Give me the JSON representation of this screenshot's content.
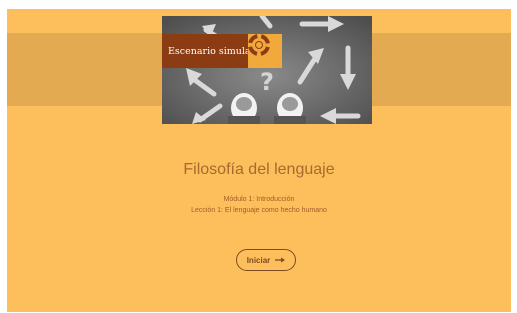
{
  "hero": {
    "badge_label": "Escenario simulado",
    "badge_icon": "lifebuoy-icon",
    "image": "shoes-and-arrows-photo"
  },
  "course": {
    "title": "Filosofía del lenguaje",
    "module": "Módulo 1: Introducción",
    "lesson": "Lección 1: El lenguaje como hecho humano"
  },
  "actions": {
    "start_label": "Iniciar",
    "start_icon": "arrow-right-icon"
  },
  "colors": {
    "background": "#fdbf5c",
    "band": "#e3aa52",
    "badge": "#8c3c12",
    "badge_icon_bg": "#f2a93b",
    "title": "#a66a2c",
    "button_border": "#7e4a22"
  }
}
